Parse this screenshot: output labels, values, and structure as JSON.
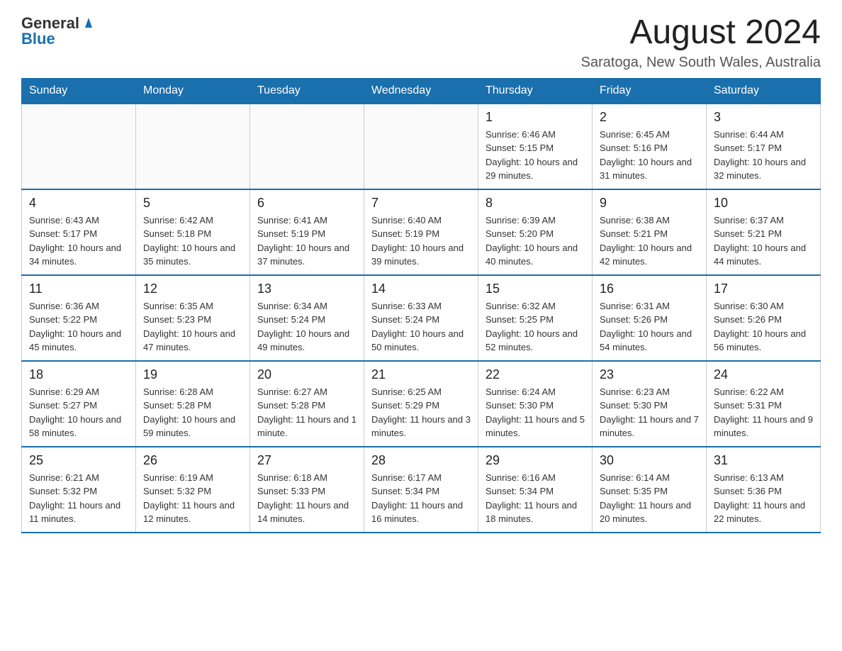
{
  "header": {
    "logo": {
      "text_general": "General",
      "text_blue": "Blue"
    },
    "month_title": "August 2024",
    "location": "Saratoga, New South Wales, Australia"
  },
  "calendar": {
    "days_of_week": [
      "Sunday",
      "Monday",
      "Tuesday",
      "Wednesday",
      "Thursday",
      "Friday",
      "Saturday"
    ],
    "weeks": [
      {
        "days": [
          {
            "number": "",
            "info": ""
          },
          {
            "number": "",
            "info": ""
          },
          {
            "number": "",
            "info": ""
          },
          {
            "number": "",
            "info": ""
          },
          {
            "number": "1",
            "info": "Sunrise: 6:46 AM\nSunset: 5:15 PM\nDaylight: 10 hours and 29 minutes."
          },
          {
            "number": "2",
            "info": "Sunrise: 6:45 AM\nSunset: 5:16 PM\nDaylight: 10 hours and 31 minutes."
          },
          {
            "number": "3",
            "info": "Sunrise: 6:44 AM\nSunset: 5:17 PM\nDaylight: 10 hours and 32 minutes."
          }
        ]
      },
      {
        "days": [
          {
            "number": "4",
            "info": "Sunrise: 6:43 AM\nSunset: 5:17 PM\nDaylight: 10 hours and 34 minutes."
          },
          {
            "number": "5",
            "info": "Sunrise: 6:42 AM\nSunset: 5:18 PM\nDaylight: 10 hours and 35 minutes."
          },
          {
            "number": "6",
            "info": "Sunrise: 6:41 AM\nSunset: 5:19 PM\nDaylight: 10 hours and 37 minutes."
          },
          {
            "number": "7",
            "info": "Sunrise: 6:40 AM\nSunset: 5:19 PM\nDaylight: 10 hours and 39 minutes."
          },
          {
            "number": "8",
            "info": "Sunrise: 6:39 AM\nSunset: 5:20 PM\nDaylight: 10 hours and 40 minutes."
          },
          {
            "number": "9",
            "info": "Sunrise: 6:38 AM\nSunset: 5:21 PM\nDaylight: 10 hours and 42 minutes."
          },
          {
            "number": "10",
            "info": "Sunrise: 6:37 AM\nSunset: 5:21 PM\nDaylight: 10 hours and 44 minutes."
          }
        ]
      },
      {
        "days": [
          {
            "number": "11",
            "info": "Sunrise: 6:36 AM\nSunset: 5:22 PM\nDaylight: 10 hours and 45 minutes."
          },
          {
            "number": "12",
            "info": "Sunrise: 6:35 AM\nSunset: 5:23 PM\nDaylight: 10 hours and 47 minutes."
          },
          {
            "number": "13",
            "info": "Sunrise: 6:34 AM\nSunset: 5:24 PM\nDaylight: 10 hours and 49 minutes."
          },
          {
            "number": "14",
            "info": "Sunrise: 6:33 AM\nSunset: 5:24 PM\nDaylight: 10 hours and 50 minutes."
          },
          {
            "number": "15",
            "info": "Sunrise: 6:32 AM\nSunset: 5:25 PM\nDaylight: 10 hours and 52 minutes."
          },
          {
            "number": "16",
            "info": "Sunrise: 6:31 AM\nSunset: 5:26 PM\nDaylight: 10 hours and 54 minutes."
          },
          {
            "number": "17",
            "info": "Sunrise: 6:30 AM\nSunset: 5:26 PM\nDaylight: 10 hours and 56 minutes."
          }
        ]
      },
      {
        "days": [
          {
            "number": "18",
            "info": "Sunrise: 6:29 AM\nSunset: 5:27 PM\nDaylight: 10 hours and 58 minutes."
          },
          {
            "number": "19",
            "info": "Sunrise: 6:28 AM\nSunset: 5:28 PM\nDaylight: 10 hours and 59 minutes."
          },
          {
            "number": "20",
            "info": "Sunrise: 6:27 AM\nSunset: 5:28 PM\nDaylight: 11 hours and 1 minute."
          },
          {
            "number": "21",
            "info": "Sunrise: 6:25 AM\nSunset: 5:29 PM\nDaylight: 11 hours and 3 minutes."
          },
          {
            "number": "22",
            "info": "Sunrise: 6:24 AM\nSunset: 5:30 PM\nDaylight: 11 hours and 5 minutes."
          },
          {
            "number": "23",
            "info": "Sunrise: 6:23 AM\nSunset: 5:30 PM\nDaylight: 11 hours and 7 minutes."
          },
          {
            "number": "24",
            "info": "Sunrise: 6:22 AM\nSunset: 5:31 PM\nDaylight: 11 hours and 9 minutes."
          }
        ]
      },
      {
        "days": [
          {
            "number": "25",
            "info": "Sunrise: 6:21 AM\nSunset: 5:32 PM\nDaylight: 11 hours and 11 minutes."
          },
          {
            "number": "26",
            "info": "Sunrise: 6:19 AM\nSunset: 5:32 PM\nDaylight: 11 hours and 12 minutes."
          },
          {
            "number": "27",
            "info": "Sunrise: 6:18 AM\nSunset: 5:33 PM\nDaylight: 11 hours and 14 minutes."
          },
          {
            "number": "28",
            "info": "Sunrise: 6:17 AM\nSunset: 5:34 PM\nDaylight: 11 hours and 16 minutes."
          },
          {
            "number": "29",
            "info": "Sunrise: 6:16 AM\nSunset: 5:34 PM\nDaylight: 11 hours and 18 minutes."
          },
          {
            "number": "30",
            "info": "Sunrise: 6:14 AM\nSunset: 5:35 PM\nDaylight: 11 hours and 20 minutes."
          },
          {
            "number": "31",
            "info": "Sunrise: 6:13 AM\nSunset: 5:36 PM\nDaylight: 11 hours and 22 minutes."
          }
        ]
      }
    ]
  }
}
